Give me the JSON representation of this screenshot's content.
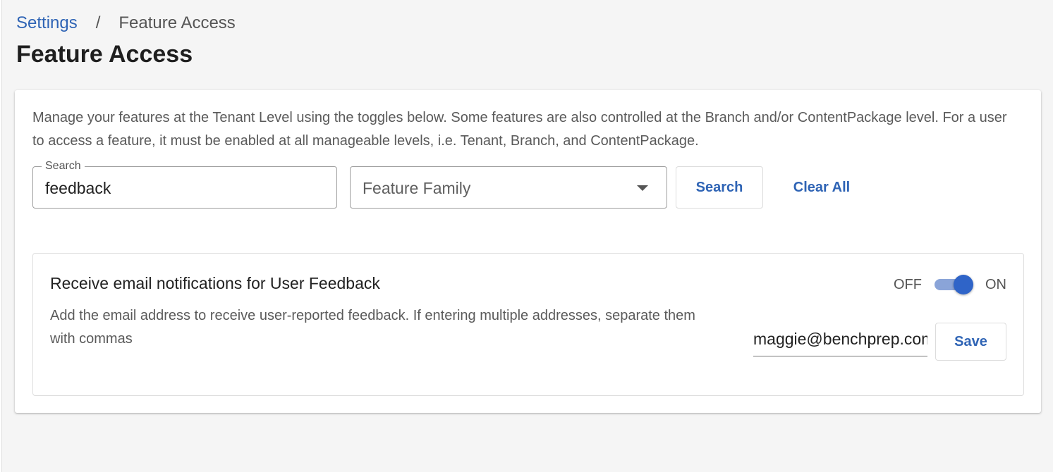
{
  "breadcrumb": {
    "parent": "Settings",
    "separator": "/",
    "current": "Feature Access"
  },
  "page": {
    "title": "Feature Access"
  },
  "intro": "Manage your features at the Tenant Level using the toggles below. Some features are also controlled at the Branch and/or ContentPackage level. For a user to access a feature, it must be enabled at all manageable levels, i.e. Tenant, Branch, and ContentPackage.",
  "filters": {
    "search_label": "Search",
    "search_value": "feedback",
    "family_placeholder": "Feature Family",
    "search_button": "Search",
    "clear_button": "Clear All"
  },
  "feature": {
    "title": "Receive email notifications for User Feedback",
    "description": "Add the email address to receive user-reported feedback. If entering multiple addresses, separate them with commas",
    "toggle_off_label": "OFF",
    "toggle_on_label": "ON",
    "toggle_state": "on",
    "email_value": "maggie@benchprep.com",
    "save_button": "Save"
  },
  "colors": {
    "link": "#2f64b5",
    "toggle_thumb": "#2f64c8",
    "toggle_track": "#8aa4d8"
  }
}
